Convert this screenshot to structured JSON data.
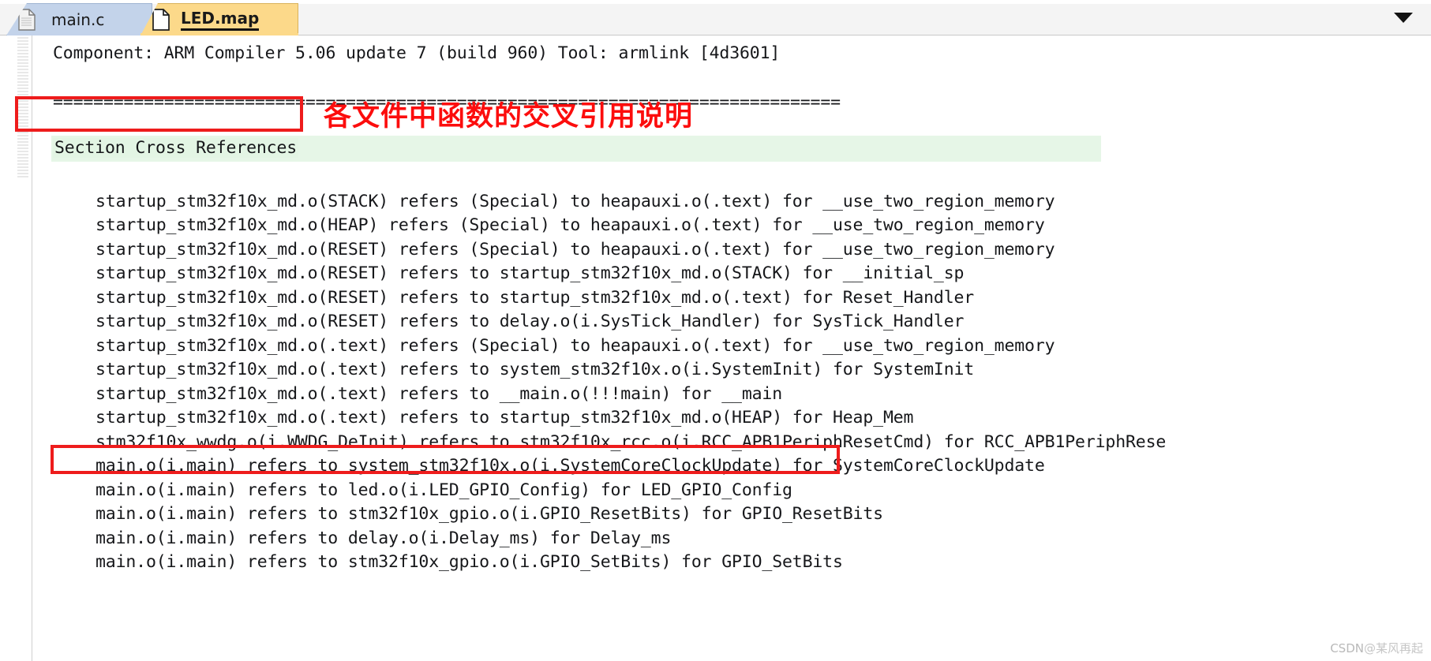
{
  "tabs": [
    {
      "label": "main.c",
      "icon": "document-icon",
      "active": false
    },
    {
      "label": "LED.map",
      "icon": "document-icon",
      "active": true
    }
  ],
  "toolbar": {
    "dropdown_icon": "chevron-down-icon"
  },
  "colors": {
    "active_tab_bg": "#fcd98a",
    "inactive_tab_bg": "#c3d3ea",
    "annotation_red": "#fc0d0d",
    "highlight_green": "#e3f5e4",
    "text": "#16171a"
  },
  "annotations": {
    "chinese_note": "各文件中函数的交叉引用说明",
    "section_box_target": "Section Cross References",
    "line_box_target": "main.o(i.main) refers to led.o(i.LED_GPIO_Config) for LED_GPIO_Config"
  },
  "document": {
    "header": "Component: ARM Compiler 5.06 update 7 (build 960) Tool: armlink [4d3601]",
    "separator": "==============================================================================",
    "section_title": "Section Cross References",
    "lines": [
      "startup_stm32f10x_md.o(STACK) refers (Special) to heapauxi.o(.text) for __use_two_region_memory",
      "startup_stm32f10x_md.o(HEAP) refers (Special) to heapauxi.o(.text) for __use_two_region_memory",
      "startup_stm32f10x_md.o(RESET) refers (Special) to heapauxi.o(.text) for __use_two_region_memory",
      "startup_stm32f10x_md.o(RESET) refers to startup_stm32f10x_md.o(STACK) for __initial_sp",
      "startup_stm32f10x_md.o(RESET) refers to startup_stm32f10x_md.o(.text) for Reset_Handler",
      "startup_stm32f10x_md.o(RESET) refers to delay.o(i.SysTick_Handler) for SysTick_Handler",
      "startup_stm32f10x_md.o(.text) refers (Special) to heapauxi.o(.text) for __use_two_region_memory",
      "startup_stm32f10x_md.o(.text) refers to system_stm32f10x.o(i.SystemInit) for SystemInit",
      "startup_stm32f10x_md.o(.text) refers to __main.o(!!!main) for __main",
      "startup_stm32f10x_md.o(.text) refers to startup_stm32f10x_md.o(HEAP) for Heap_Mem",
      "stm32f10x_wwdg.o(i.WWDG_DeInit) refers to stm32f10x_rcc.o(i.RCC_APB1PeriphResetCmd) for RCC_APB1PeriphRese",
      "main.o(i.main) refers to system_stm32f10x.o(i.SystemCoreClockUpdate) for SystemCoreClockUpdate",
      "main.o(i.main) refers to led.o(i.LED_GPIO_Config) for LED_GPIO_Config",
      "main.o(i.main) refers to stm32f10x_gpio.o(i.GPIO_ResetBits) for GPIO_ResetBits",
      "main.o(i.main) refers to delay.o(i.Delay_ms) for Delay_ms",
      "main.o(i.main) refers to stm32f10x_gpio.o(i.GPIO_SetBits) for GPIO_SetBits"
    ]
  },
  "watermark": {
    "prefix": "CSDN",
    "suffix": "@某风再起"
  }
}
